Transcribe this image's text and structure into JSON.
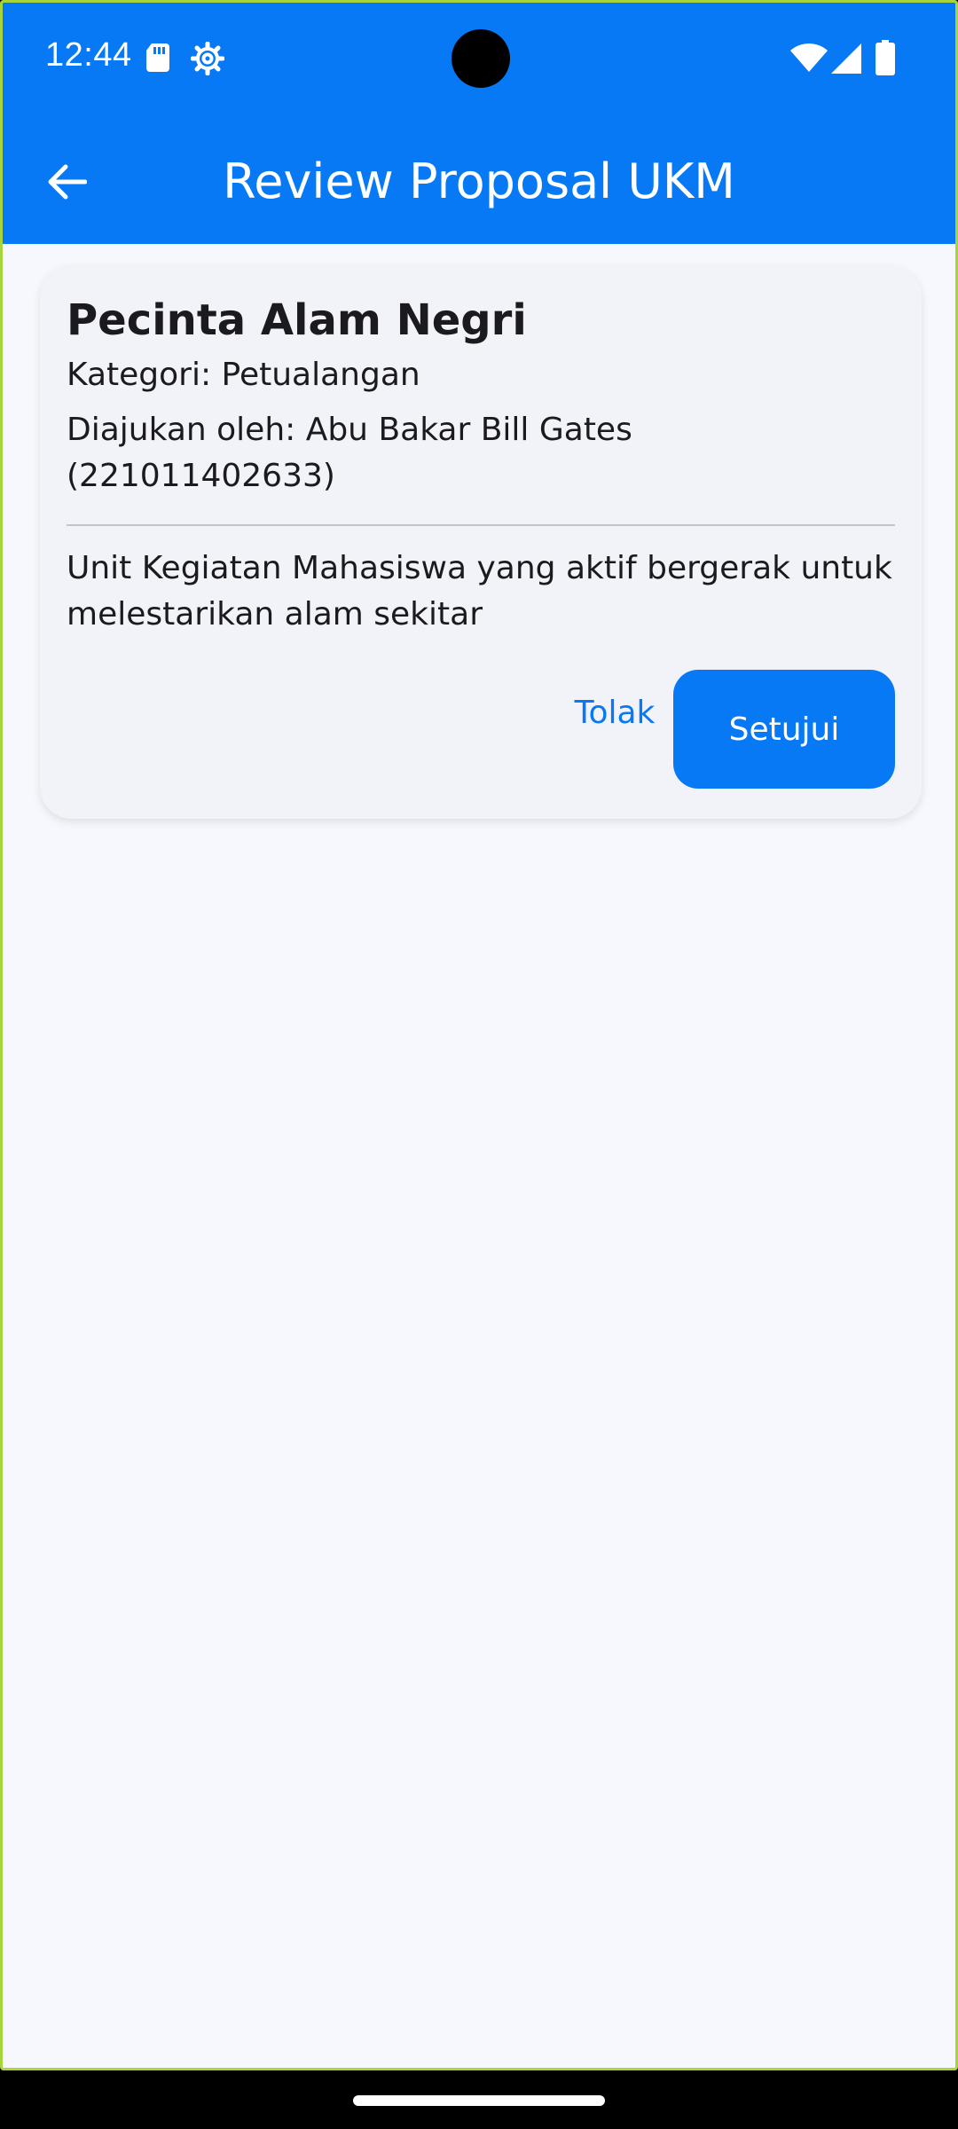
{
  "status_bar": {
    "time": "12:44",
    "icons": [
      "sd-card-icon",
      "settings-icon",
      "wifi-icon",
      "signal-icon",
      "battery-icon"
    ]
  },
  "app_bar": {
    "title": "Review Proposal UKM",
    "back_icon": "arrow-left-icon"
  },
  "proposal": {
    "name": "Pecinta Alam Negri",
    "category": "Kategori: Petualangan",
    "submitter": "Diajukan oleh: Abu Bakar Bill Gates (221011402633)",
    "description": "Unit Kegiatan Mahasiswa yang aktif bergerak untuk melestarikan alam sekitar",
    "reject_label": "Tolak",
    "approve_label": "Setujui"
  },
  "colors": {
    "primary": "#0779F4",
    "background": "#F7F8FD",
    "card": "#F2F3F9",
    "text": "#1B1B1F"
  }
}
